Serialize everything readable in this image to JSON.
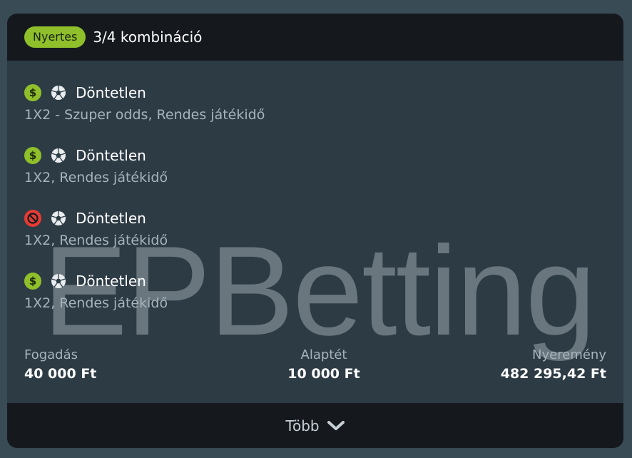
{
  "header": {
    "status_badge": "Nyertes",
    "title": "3/4 kombináció"
  },
  "legs": [
    {
      "status": "won",
      "status_icon": "dollar-icon",
      "sport_icon": "soccer-ball-icon",
      "selection": "Döntetlen",
      "market": "1X2 - Szuper odds, Rendes játékidő"
    },
    {
      "status": "won",
      "status_icon": "dollar-icon",
      "sport_icon": "soccer-ball-icon",
      "selection": "Döntetlen",
      "market": "1X2, Rendes játékidő"
    },
    {
      "status": "lost",
      "status_icon": "no-entry-icon",
      "sport_icon": "soccer-ball-icon",
      "selection": "Döntetlen",
      "market": "1X2, Rendes játékidő"
    },
    {
      "status": "won",
      "status_icon": "dollar-icon",
      "sport_icon": "soccer-ball-icon",
      "selection": "Döntetlen",
      "market": "1X2, Rendes játékidő"
    }
  ],
  "watermark": "EPBetting",
  "totals": {
    "stake": {
      "label": "Fogadás",
      "value": "40 000 Ft"
    },
    "base": {
      "label": "Alaptét",
      "value": "10 000 Ft"
    },
    "winnings": {
      "label": "Nyeremény",
      "value": "482 295,42 Ft"
    }
  },
  "footer": {
    "more_label": "Több"
  },
  "colors": {
    "won": "#8fbf2a",
    "lost": "#e43b34",
    "card_bg": "#2d3b45",
    "header_bg": "#15191e"
  }
}
